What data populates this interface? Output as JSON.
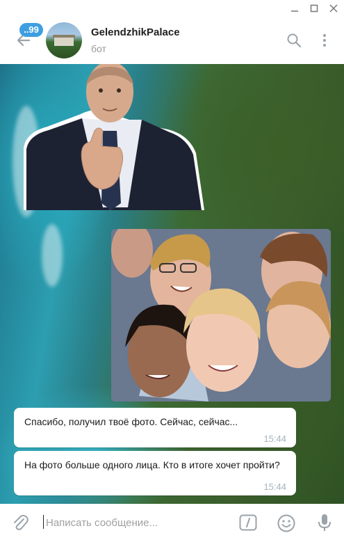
{
  "window": {
    "controls": [
      "minimize-icon",
      "maximize-icon",
      "close-icon"
    ]
  },
  "header": {
    "unread_badge": "..99",
    "chat_title": "GelendzhikPalace",
    "chat_subtitle": "бот",
    "icons": [
      "arrow-left-icon",
      "search-icon",
      "more-vertical-icon"
    ]
  },
  "messages": [
    {
      "type": "sticker",
      "description_icon": "thumbs-up-sticker"
    },
    {
      "type": "photo",
      "description_icon": "group-selfie-photo"
    },
    {
      "type": "text",
      "text": "Спасибо, получил твоё фото. Сейчас, сейчас...",
      "time": "15:44"
    },
    {
      "type": "text",
      "text": "На фото больше одного лица. Кто в итоге хочет пройти?",
      "time": "15:44"
    }
  ],
  "composer": {
    "placeholder": "Написать сообщение...",
    "icons": [
      "paperclip-icon",
      "bot-command-icon",
      "emoji-icon",
      "microphone-icon"
    ]
  },
  "colors": {
    "accent": "#3e9fe0",
    "time_text": "#a4b2bd"
  }
}
